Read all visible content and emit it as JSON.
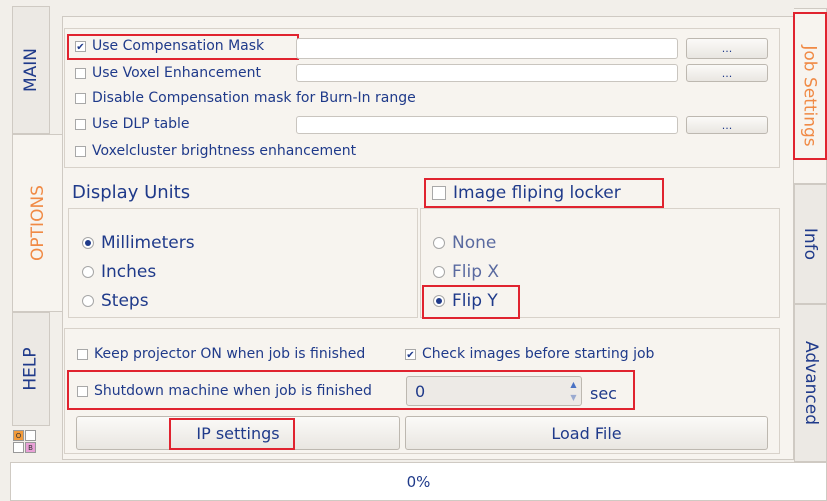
{
  "tabs_left": {
    "main": "MAIN",
    "options": "OPTIONS",
    "help": "HELP"
  },
  "tabs_right": {
    "job_settings": "Job Settings",
    "info": "Info",
    "advanced": "Advanced"
  },
  "mask_options": {
    "compensation_mask": {
      "label": "Use Compensation Mask",
      "checked": true,
      "browse": "..."
    },
    "voxel_enhancement": {
      "label": "Use Voxel Enhancement",
      "checked": false,
      "browse": "..."
    },
    "disable_comp_burnin": {
      "label": "Disable Compensation mask for Burn-In range",
      "checked": false
    },
    "dlp_table": {
      "label": "Use DLP table",
      "checked": false,
      "browse": "..."
    },
    "voxelcluster": {
      "label": "Voxelcluster brightness enhancement",
      "checked": false
    }
  },
  "display_units": {
    "title": "Display Units",
    "options": [
      "Millimeters",
      "Inches",
      "Steps"
    ],
    "selected": "Millimeters"
  },
  "image_flip": {
    "locker_label": "Image fliping locker",
    "locker_checked": false,
    "options": [
      "None",
      "Flip X",
      "Flip Y"
    ],
    "selected": "Flip Y"
  },
  "job": {
    "keep_projector": {
      "label": "Keep projector ON when job is finished",
      "checked": false
    },
    "check_images": {
      "label": "Check images before starting job",
      "checked": true
    },
    "shutdown": {
      "label": "Shutdown machine when job is finished",
      "checked": false
    },
    "shutdown_delay": "0",
    "unit": "sec",
    "ip_settings": "IP settings",
    "load_file": "Load File"
  },
  "legend": {
    "o": "O",
    "b": "B"
  },
  "progress": {
    "text": "0%",
    "value": 0
  }
}
